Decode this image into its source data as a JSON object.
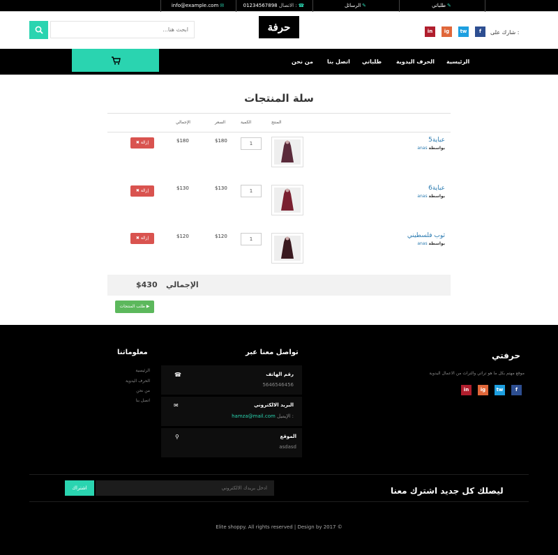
{
  "topbar": {
    "email": "info@example.com",
    "phone": "01234567898",
    "phone_label": "الاتصال :",
    "messages": "الرسائل",
    "orders": "طلباتي"
  },
  "header": {
    "search_placeholder": "ابحث هنا...",
    "logo": "حرفة",
    "share_label": "شارك على :",
    "social": [
      "in",
      "ig",
      "tw",
      "f"
    ]
  },
  "nav": {
    "items": [
      "الرئيسية",
      "الحرف اليدوية",
      "طلباتي",
      "اتصل بنا",
      "من نحن"
    ],
    "cart_icon": "cart-icon"
  },
  "cart": {
    "title": "سلة المنتجات",
    "headers": {
      "product": "المنتج",
      "qty": "الكمية",
      "price": "السعر",
      "total": "الإجمالي"
    },
    "items": [
      {
        "name": "عباية5",
        "by_label": "بواسطة",
        "seller": "anas",
        "qty": "1",
        "price": "$180",
        "total": "$180",
        "delete": "إزالة"
      },
      {
        "name": "عباية6",
        "by_label": "بواسطة",
        "seller": "anas",
        "qty": "1",
        "price": "$130",
        "total": "$130",
        "delete": "إزالة"
      },
      {
        "name": "ثوب فلسطيني",
        "by_label": "بواسطة",
        "seller": "anas",
        "qty": "1",
        "price": "$120",
        "total": "$120",
        "delete": "إزالة"
      }
    ],
    "total_label": "الإجمالي",
    "total_value": "$430",
    "order_button": "طلب المنتجات"
  },
  "footer": {
    "brand_title": "حرفتي",
    "brand_desc": "موقع مهتم بكل ما هو تراثي والتراث من الاعمال اليدوية",
    "contact_title": "تواصل معنا عبر",
    "contact": [
      {
        "title": "رقم الهاتف",
        "value": "5646546456"
      },
      {
        "title": "البريد الالكتروني",
        "value_label": "الإيميل :",
        "value": "hamza@mail.com"
      },
      {
        "title": "الموقع",
        "value": "asdasd"
      }
    ],
    "info_title": "معلوماتنا",
    "info_links": [
      "الرئيسية",
      "الحرف اليدوية",
      "من نحن",
      "اتصل بنا"
    ],
    "subscribe_title": "ليصلك كل جديد اشترك معنا",
    "subscribe_placeholder": "ادخل بريدك الالكتروني",
    "subscribe_button": "اشتراك",
    "copyright": "Elite shoppy. All rights reserved | Design by 2017 ©"
  },
  "colors": {
    "accent": "#2ad4b0",
    "danger": "#d9534f",
    "success": "#5cb85c",
    "link": "#2a7ab0"
  }
}
